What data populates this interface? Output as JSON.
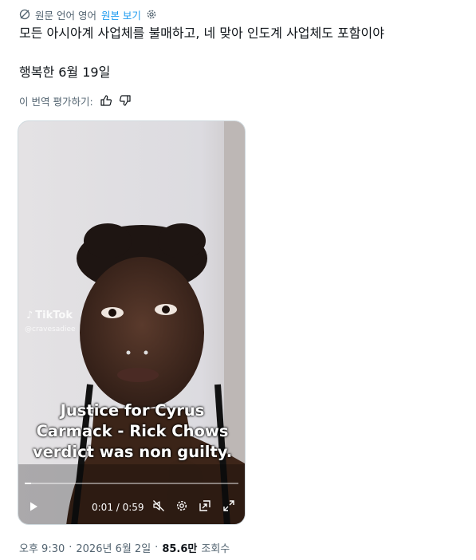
{
  "translation": {
    "source_label": "원문 언어 영어",
    "show_original": "원본 보기"
  },
  "tweet": {
    "text": "모든 아시아계 사업체를 불매하고, 네 맞아 인도계 사업체도 포함이야",
    "date_line": "행복한 6월 19일"
  },
  "rating": {
    "label": "이 번역 평가하기:"
  },
  "video": {
    "watermark": "TikTok",
    "watermark_user": "@cravesadiee",
    "caption_lines": [
      "Justice for Cyrus",
      "Carmack - Rick Chows",
      "verdict was non guilty."
    ],
    "time_display": "0:01 / 0:59",
    "progress": 0.03
  },
  "footer": {
    "time": "오후 9:30",
    "sep1": "·",
    "date": "2026년 6월 2일",
    "sep2": "·",
    "views": "85.6만",
    "views_label": "조회수"
  },
  "icons": {
    "translate": "no-globe-icon",
    "settings": "gear-icon",
    "thumbs_up": "thumbs-up-icon",
    "thumbs_down": "thumbs-down-icon",
    "play": "play-icon",
    "mute": "muted-speaker-icon",
    "video_settings": "gear-icon",
    "pip": "picture-in-picture-icon",
    "fullscreen": "fullscreen-icon"
  },
  "colors": {
    "link": "#1d9bf0",
    "secondary_text": "#536471",
    "primary_text": "#0f1419"
  }
}
